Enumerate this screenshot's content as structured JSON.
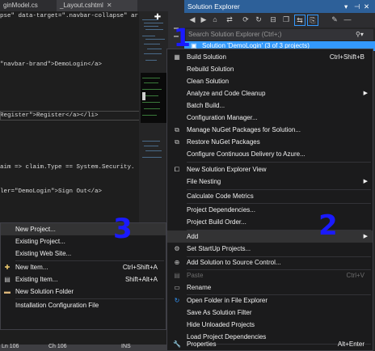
{
  "tabs": [
    {
      "label": "ginModel.cs"
    },
    {
      "label": "_Layout.cshtml"
    }
  ],
  "code_lines": [
    {
      "text": "pse\" data-target=\".navbar-collapse\" ar"
    },
    {
      "text": "\"navbar-brand\">DemoLogin</a>"
    },
    {
      "text": "Register\">Register</a></li>"
    },
    {
      "text": "aim => claim.Type == System.Security."
    },
    {
      "text": "ler=\"DemoLogin\">Sign Out</a>"
    }
  ],
  "status_bar": {
    "line": "Ln 106",
    "col": "Ch 106",
    "mode": "INS"
  },
  "solution_explorer": {
    "title": "Solution Explorer",
    "search_placeholder": "Search Solution Explorer (Ctrl+;)",
    "root_item": "Solution 'DemoLogin' (3 of 3 projects)"
  },
  "context_menu": {
    "items": [
      {
        "label": "Build Solution",
        "shortcut": "Ctrl+Shift+B",
        "icon": "build-icon"
      },
      {
        "label": "Rebuild Solution",
        "shortcut": ""
      },
      {
        "label": "Clean Solution",
        "shortcut": ""
      },
      {
        "label": "Analyze and Code Cleanup",
        "shortcut": "",
        "submenu": true
      },
      {
        "label": "Batch Build...",
        "shortcut": ""
      },
      {
        "label": "Configuration Manager...",
        "shortcut": ""
      },
      {
        "label": "Manage NuGet Packages for Solution...",
        "shortcut": "",
        "icon": "nuget-icon"
      },
      {
        "label": "Restore NuGet Packages",
        "shortcut": "",
        "icon": "restore-icon"
      },
      {
        "label": "Configure Continuous Delivery to Azure...",
        "shortcut": ""
      },
      {
        "label": "New Solution Explorer View",
        "shortcut": "",
        "icon": "new-view-icon"
      },
      {
        "label": "File Nesting",
        "shortcut": "",
        "submenu": true
      },
      {
        "label": "Calculate Code Metrics",
        "shortcut": ""
      },
      {
        "label": "Project Dependencies...",
        "shortcut": ""
      },
      {
        "label": "Project Build Order...",
        "shortcut": ""
      },
      {
        "label": "Add",
        "shortcut": "",
        "submenu": true
      },
      {
        "label": "Set StartUp Projects...",
        "shortcut": "",
        "icon": "gear-icon"
      },
      {
        "label": "Add Solution to Source Control...",
        "shortcut": "",
        "icon": "source-control-icon"
      },
      {
        "label": "Paste",
        "shortcut": "Ctrl+V",
        "disabled": true,
        "icon": "paste-icon"
      },
      {
        "label": "Rename",
        "shortcut": "",
        "icon": "rename-icon"
      },
      {
        "label": "Open Folder in File Explorer",
        "shortcut": "",
        "icon": "refresh-icon"
      },
      {
        "label": "Save As Solution Filter",
        "shortcut": ""
      },
      {
        "label": "Hide Unloaded Projects",
        "shortcut": ""
      },
      {
        "label": "Load Project Dependencies",
        "shortcut": ""
      },
      {
        "label": "Properties",
        "shortcut": "Alt+Enter",
        "icon": "wrench-icon"
      }
    ]
  },
  "add_submenu": {
    "items": [
      {
        "label": "New Project...",
        "shortcut": ""
      },
      {
        "label": "Existing Project...",
        "shortcut": ""
      },
      {
        "label": "Existing Web Site...",
        "shortcut": ""
      },
      {
        "label": "New Item...",
        "shortcut": "Ctrl+Shift+A",
        "icon": "new-item-icon"
      },
      {
        "label": "Existing Item...",
        "shortcut": "Shift+Alt+A",
        "icon": "existing-item-icon"
      },
      {
        "label": "New Solution Folder",
        "shortcut": "",
        "icon": "folder-icon"
      },
      {
        "label": "Installation Configuration File",
        "shortcut": ""
      }
    ]
  },
  "annotations": [
    "1",
    "2",
    "3"
  ],
  "colors": {
    "accent": "#3399ff",
    "annotation": "#1a1aff",
    "title_bar": "#2d6099"
  }
}
